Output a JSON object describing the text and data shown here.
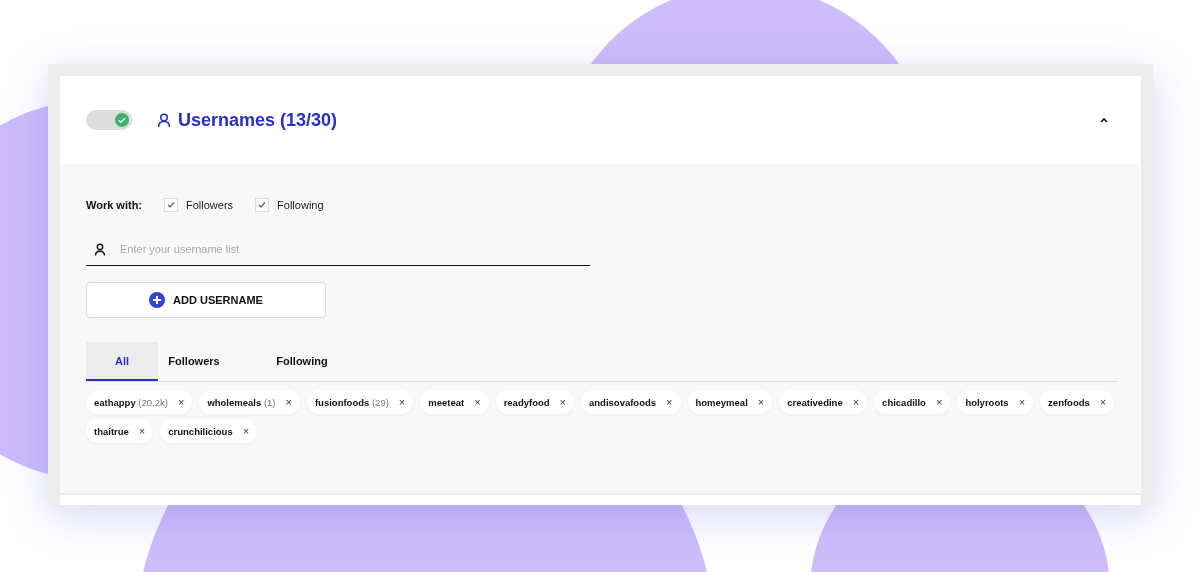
{
  "section": {
    "enabled": true,
    "title": "Usernames (13/30)",
    "expanded": true
  },
  "work_with": {
    "label": "Work with:",
    "options": [
      {
        "label": "Followers",
        "checked": true
      },
      {
        "label": "Following",
        "checked": true
      }
    ]
  },
  "input": {
    "placeholder": "Enter your username list"
  },
  "add_button": {
    "label": "ADD USERNAME"
  },
  "tabs": [
    {
      "label": "All",
      "selected": true
    },
    {
      "label": "Followers",
      "selected": false
    },
    {
      "label": "Following",
      "selected": false
    }
  ],
  "chips": [
    {
      "name": "eathappy",
      "count": "(20.2k)"
    },
    {
      "name": "wholemeals",
      "count": "(1)"
    },
    {
      "name": "fusionfoods",
      "count": "(29)"
    },
    {
      "name": "meeteat"
    },
    {
      "name": "readyfood"
    },
    {
      "name": "andisovafoods"
    },
    {
      "name": "homeymeal"
    },
    {
      "name": "creativedine"
    },
    {
      "name": "chicadillo"
    },
    {
      "name": "holyroots"
    },
    {
      "name": "zenfoods"
    },
    {
      "name": "thaitrue"
    },
    {
      "name": "crunchilicious"
    }
  ],
  "chip_remove": "×"
}
